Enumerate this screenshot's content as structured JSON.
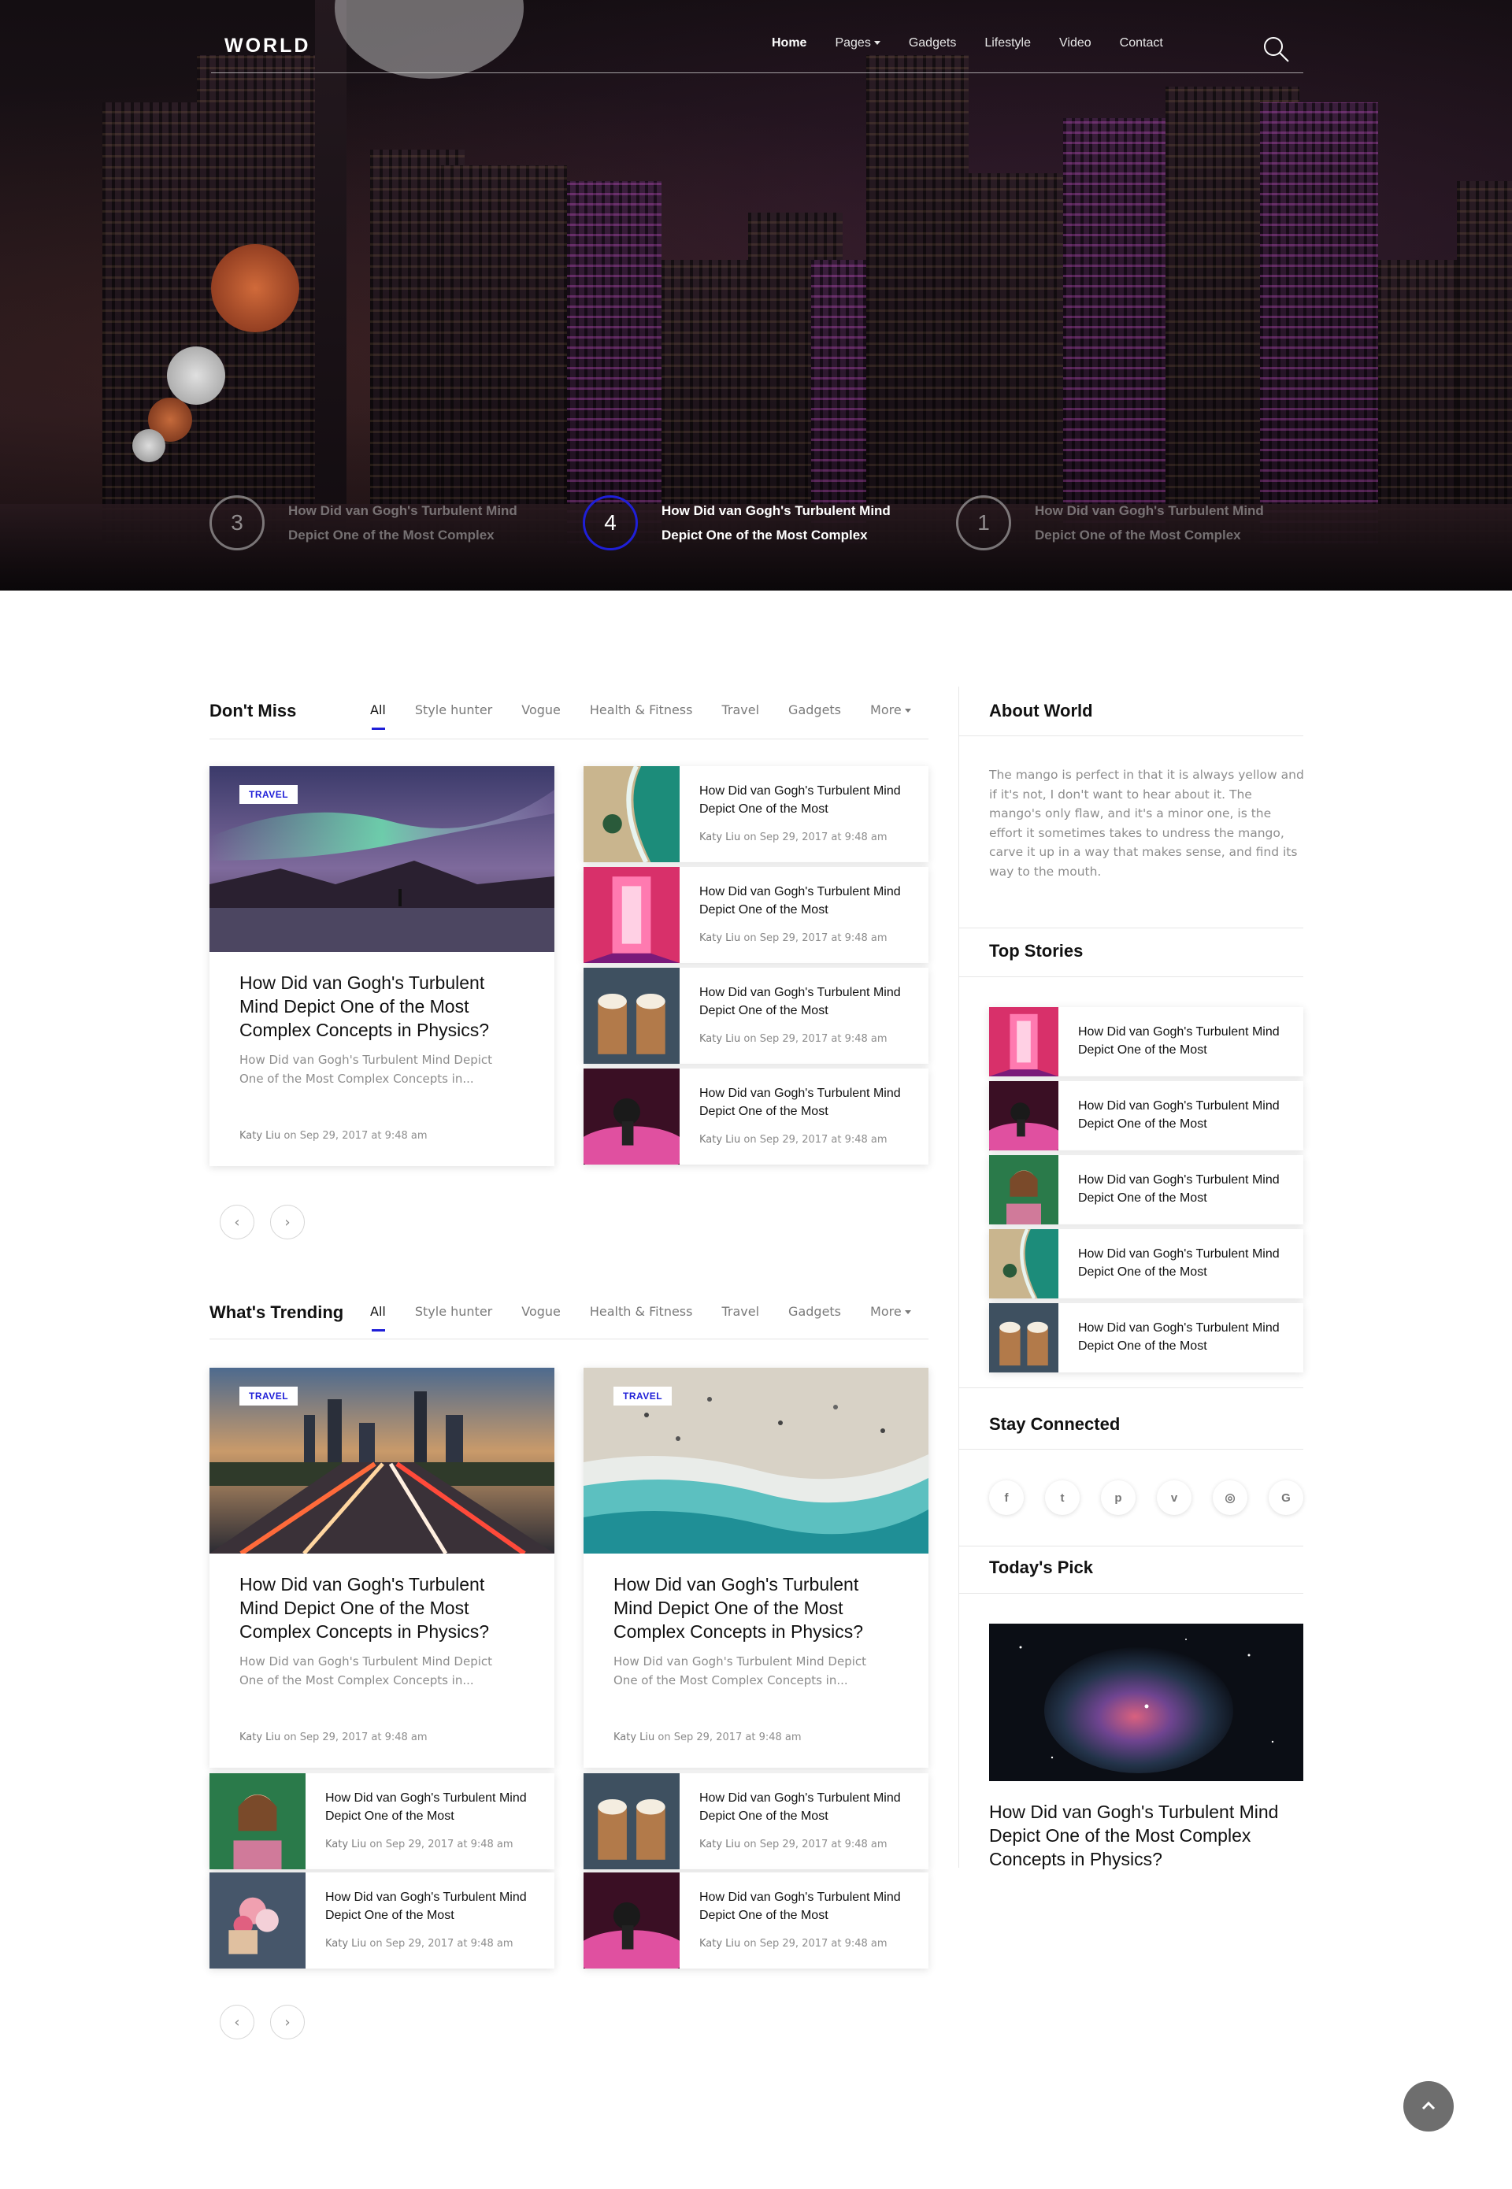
{
  "header": {
    "logo": "WORLD",
    "nav": [
      {
        "label": "Home",
        "active": true,
        "dropdown": false
      },
      {
        "label": "Pages",
        "active": false,
        "dropdown": true
      },
      {
        "label": "Gadgets",
        "active": false,
        "dropdown": false
      },
      {
        "label": "Lifestyle",
        "active": false,
        "dropdown": false
      },
      {
        "label": "Video",
        "active": false,
        "dropdown": false
      },
      {
        "label": "Contact",
        "active": false,
        "dropdown": false
      }
    ],
    "search_icon": "search-icon"
  },
  "hero": {
    "slides": [
      {
        "num": "3",
        "text": "How Did van Gogh's Turbulent Mind Depict One of the Most Complex",
        "active": false
      },
      {
        "num": "4",
        "text": "How Did van Gogh's Turbulent Mind Depict One of the Most Complex",
        "active": true
      },
      {
        "num": "1",
        "text": "How Did van Gogh's Turbulent Mind Depict One of the Most Complex",
        "active": false
      }
    ]
  },
  "tabs": [
    "All",
    "Style hunter",
    "Vogue",
    "Health & Fitness",
    "Travel",
    "Gadgets",
    "More"
  ],
  "dont_miss": {
    "title": "Don't Miss",
    "feature": {
      "badge": "TRAVEL",
      "title": "How Did van Gogh's Turbulent Mind Depict One of the Most Complex Concepts in Physics?",
      "excerpt": "How Did van Gogh's Turbulent Mind Depict One of the Most Complex Concepts in...",
      "author": "Katy Liu",
      "date": "on Sep 29, 2017 at 9:48 am"
    },
    "list": [
      {
        "title": "How Did van Gogh's Turbulent Mind Depict One of the Most",
        "author": "Katy Liu",
        "date": "on Sep 29, 2017 at 9:48 am"
      },
      {
        "title": "How Did van Gogh's Turbulent Mind Depict One of the Most",
        "author": "Katy Liu",
        "date": "on Sep 29, 2017 at 9:48 am"
      },
      {
        "title": "How Did van Gogh's Turbulent Mind Depict One of the Most",
        "author": "Katy Liu",
        "date": "on Sep 29, 2017 at 9:48 am"
      },
      {
        "title": "How Did van Gogh's Turbulent Mind Depict One of the Most",
        "author": "Katy Liu",
        "date": "on Sep 29, 2017 at 9:48 am"
      }
    ]
  },
  "trending": {
    "title": "What's Trending",
    "features": [
      {
        "badge": "TRAVEL",
        "title": "How Did van Gogh's Turbulent Mind Depict One of the Most Complex Concepts in Physics?",
        "excerpt": "How Did van Gogh's Turbulent Mind Depict One of the Most Complex Concepts in...",
        "author": "Katy Liu",
        "date": "on Sep 29, 2017 at 9:48 am"
      },
      {
        "badge": "TRAVEL",
        "title": "How Did van Gogh's Turbulent Mind Depict One of the Most Complex Concepts in Physics?",
        "excerpt": "How Did van Gogh's Turbulent Mind Depict One of the Most Complex Concepts in...",
        "author": "Katy Liu",
        "date": "on Sep 29, 2017 at 9:48 am"
      }
    ],
    "list": [
      {
        "title": "How Did van Gogh's Turbulent Mind Depict One of the Most",
        "author": "Katy Liu",
        "date": "on Sep 29, 2017 at 9:48 am"
      },
      {
        "title": "How Did van Gogh's Turbulent Mind Depict One of the Most",
        "author": "Katy Liu",
        "date": "on Sep 29, 2017 at 9:48 am"
      },
      {
        "title": "How Did van Gogh's Turbulent Mind Depict One of the Most",
        "author": "Katy Liu",
        "date": "on Sep 29, 2017 at 9:48 am"
      },
      {
        "title": "How Did van Gogh's Turbulent Mind Depict One of the Most",
        "author": "Katy Liu",
        "date": "on Sep 29, 2017 at 9:48 am"
      }
    ]
  },
  "sidebar": {
    "about_title": "About World",
    "about_text": "The mango is perfect in that it is always yellow and if it's not, I don't want to hear about it. The mango's only flaw, and it's a minor one, is the effort it sometimes takes to undress the mango, carve it up in a way that makes sense, and find its way to the mouth.",
    "top_title": "Top Stories",
    "top_stories": [
      {
        "title": "How Did van Gogh's Turbulent Mind Depict One of the Most"
      },
      {
        "title": "How Did van Gogh's Turbulent Mind Depict One of the Most"
      },
      {
        "title": "How Did van Gogh's Turbulent Mind Depict One of the Most"
      },
      {
        "title": "How Did van Gogh's Turbulent Mind Depict One of the Most"
      },
      {
        "title": "How Did van Gogh's Turbulent Mind Depict One of the Most"
      }
    ],
    "connected_title": "Stay Connected",
    "social": [
      {
        "glyph": "f",
        "icon": "facebook-icon"
      },
      {
        "glyph": "t",
        "icon": "twitter-icon"
      },
      {
        "glyph": "p",
        "icon": "pinterest-icon"
      },
      {
        "glyph": "v",
        "icon": "vimeo-icon"
      },
      {
        "glyph": "◎",
        "icon": "instagram-icon"
      },
      {
        "glyph": "G",
        "icon": "google-icon"
      }
    ],
    "pick_title": "Today's Pick",
    "pick_caption": "How Did van Gogh's Turbulent Mind Depict One of the Most Complex Concepts in Physics?"
  },
  "colors": {
    "accent": "#1f1fd8",
    "muted": "#8d8d8d"
  }
}
